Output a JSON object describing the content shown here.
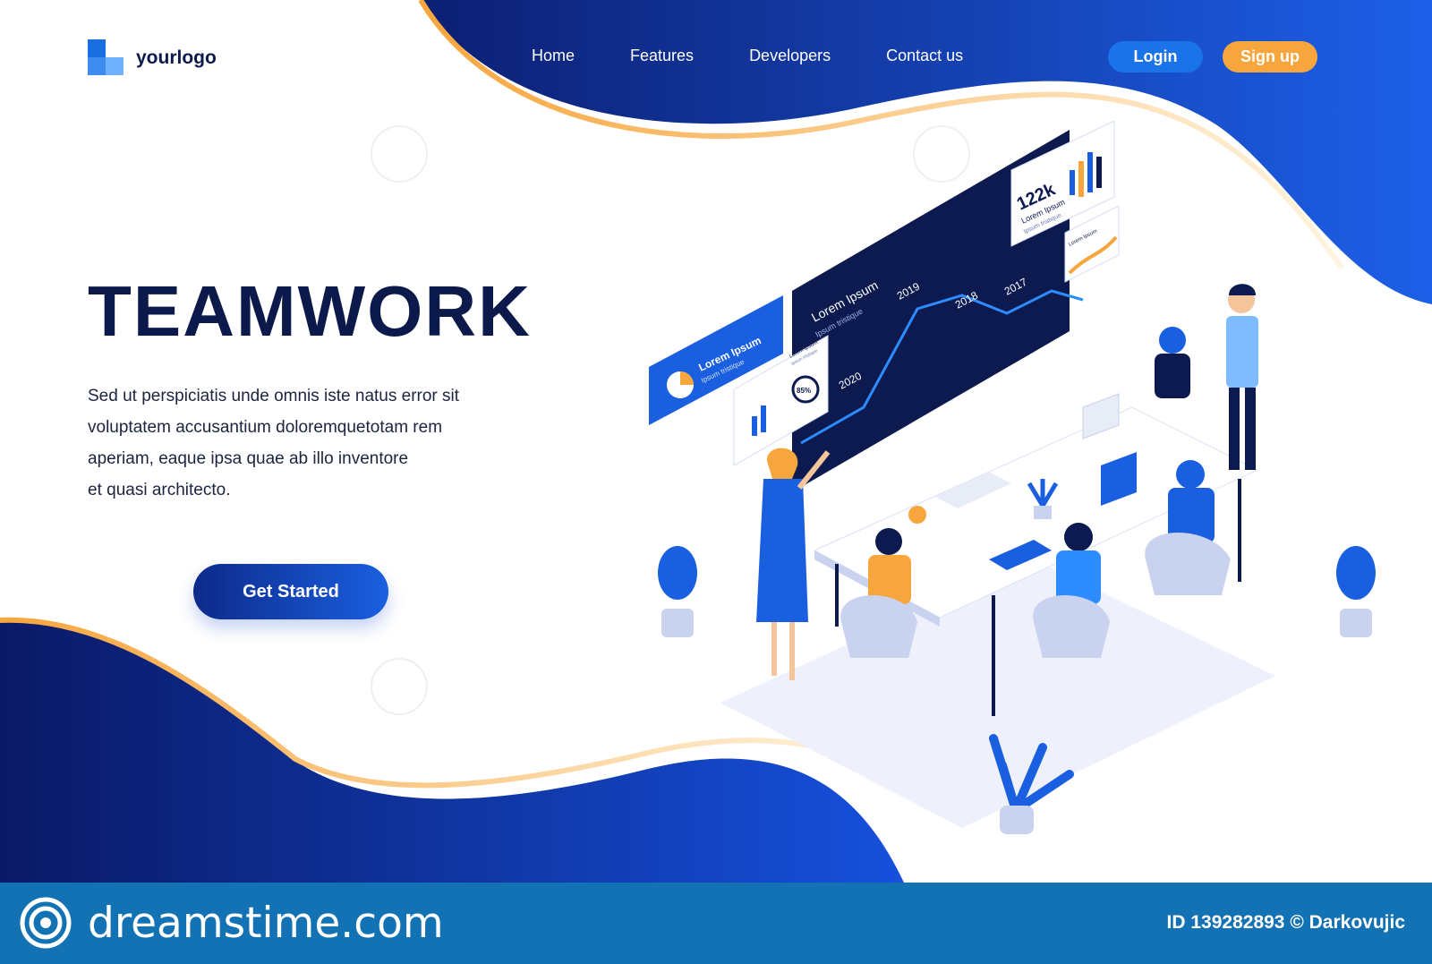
{
  "brand": {
    "logo_text": "yourlogo"
  },
  "nav": {
    "items": [
      "Home",
      "Features",
      "Developers",
      "Contact us"
    ],
    "login_label": "Login",
    "signup_label": "Sign up"
  },
  "hero": {
    "title": "TEAMWORK",
    "paragraph_lines": [
      "Sed ut perspiciatis unde omnis iste natus error sit",
      "voluptatem accusantium doloremquetotam rem",
      "aperiam, eaque ipsa quae ab illo inventore",
      "et quasi architecto."
    ],
    "cta_label": "Get Started"
  },
  "illustration": {
    "board_title": "Lorem Ipsum",
    "board_subtitle": "Ipsum tristique",
    "years": [
      "2020",
      "2019",
      "2018",
      "2017"
    ],
    "stat_value": "122k",
    "stat_label": "Lorem Ipsum",
    "stat_sublabel": "Ipsum tristique",
    "left_card_title": "Lorem Ipsum",
    "left_card_subtitle": "Ipsum tristique",
    "small_card_title": "Lorem Ipsum",
    "small_card_subtitle": "Ipsum tristique",
    "percent": "85%",
    "side_card_title": "Lorem Ipsum"
  },
  "footer": {
    "site": "dreamstime.com",
    "credit": "ID 139282893 © Darkovujic"
  },
  "colors": {
    "navy": "#0b1a4a",
    "blue": "#1a73e8",
    "orange": "#f7a63e",
    "footer": "#1272b3"
  }
}
